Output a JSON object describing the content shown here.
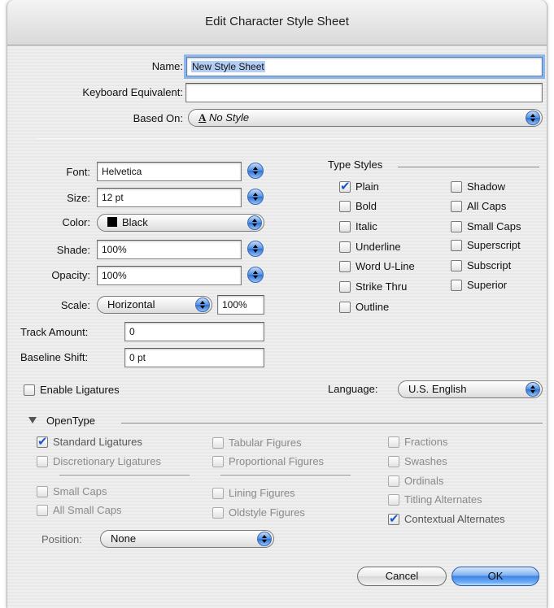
{
  "window": {
    "title": "Edit Character Style Sheet"
  },
  "name": {
    "label": "Name:",
    "value": "New Style Sheet"
  },
  "keyboard": {
    "label": "Keyboard Equivalent:",
    "value": ""
  },
  "based_on": {
    "label": "Based On:",
    "glyph": "A",
    "value": "No Style"
  },
  "font": {
    "label": "Font:",
    "value": "Helvetica"
  },
  "size": {
    "label": "Size:",
    "value": "12 pt"
  },
  "color": {
    "label": "Color:",
    "value": "Black",
    "swatch": "#000000"
  },
  "shade": {
    "label": "Shade:",
    "value": "100%"
  },
  "opacity": {
    "label": "Opacity:",
    "value": "100%"
  },
  "scale": {
    "label": "Scale:",
    "direction": "Horizontal",
    "value": "100%"
  },
  "track": {
    "label": "Track Amount:",
    "value": "0"
  },
  "baseline": {
    "label": "Baseline Shift:",
    "value": "0 pt"
  },
  "type_styles": {
    "title": "Type Styles",
    "left": [
      {
        "label": "Plain",
        "checked": true
      },
      {
        "label": "Bold",
        "checked": false
      },
      {
        "label": "Italic",
        "checked": false
      },
      {
        "label": "Underline",
        "checked": false
      },
      {
        "label": "Word U-Line",
        "checked": false
      },
      {
        "label": "Strike Thru",
        "checked": false
      },
      {
        "label": "Outline",
        "checked": false
      }
    ],
    "right": [
      {
        "label": "Shadow",
        "checked": false
      },
      {
        "label": "All Caps",
        "checked": false
      },
      {
        "label": "Small Caps",
        "checked": false
      },
      {
        "label": "Superscript",
        "checked": false
      },
      {
        "label": "Subscript",
        "checked": false
      },
      {
        "label": "Superior",
        "checked": false
      }
    ]
  },
  "ligatures": {
    "label": "Enable Ligatures",
    "checked": false
  },
  "language": {
    "label": "Language:",
    "value": "U.S. English"
  },
  "opentype": {
    "title": "OpenType",
    "col1": [
      {
        "label": "Standard Ligatures",
        "checked": true
      },
      {
        "label": "Discretionary Ligatures",
        "checked": false
      },
      {
        "label": "Small Caps",
        "checked": false
      },
      {
        "label": "All Small Caps",
        "checked": false
      }
    ],
    "col2": [
      {
        "label": "Tabular Figures",
        "checked": false
      },
      {
        "label": "Proportional Figures",
        "checked": false
      },
      {
        "label": "Lining Figures",
        "checked": false
      },
      {
        "label": "Oldstyle Figures",
        "checked": false
      }
    ],
    "col3": [
      {
        "label": "Fractions",
        "checked": false
      },
      {
        "label": "Swashes",
        "checked": false
      },
      {
        "label": "Ordinals",
        "checked": false
      },
      {
        "label": "Titling Alternates",
        "checked": false
      },
      {
        "label": "Contextual Alternates",
        "checked": true
      }
    ],
    "position": {
      "label": "Position:",
      "value": "None"
    }
  },
  "buttons": {
    "cancel": "Cancel",
    "ok": "OK"
  }
}
